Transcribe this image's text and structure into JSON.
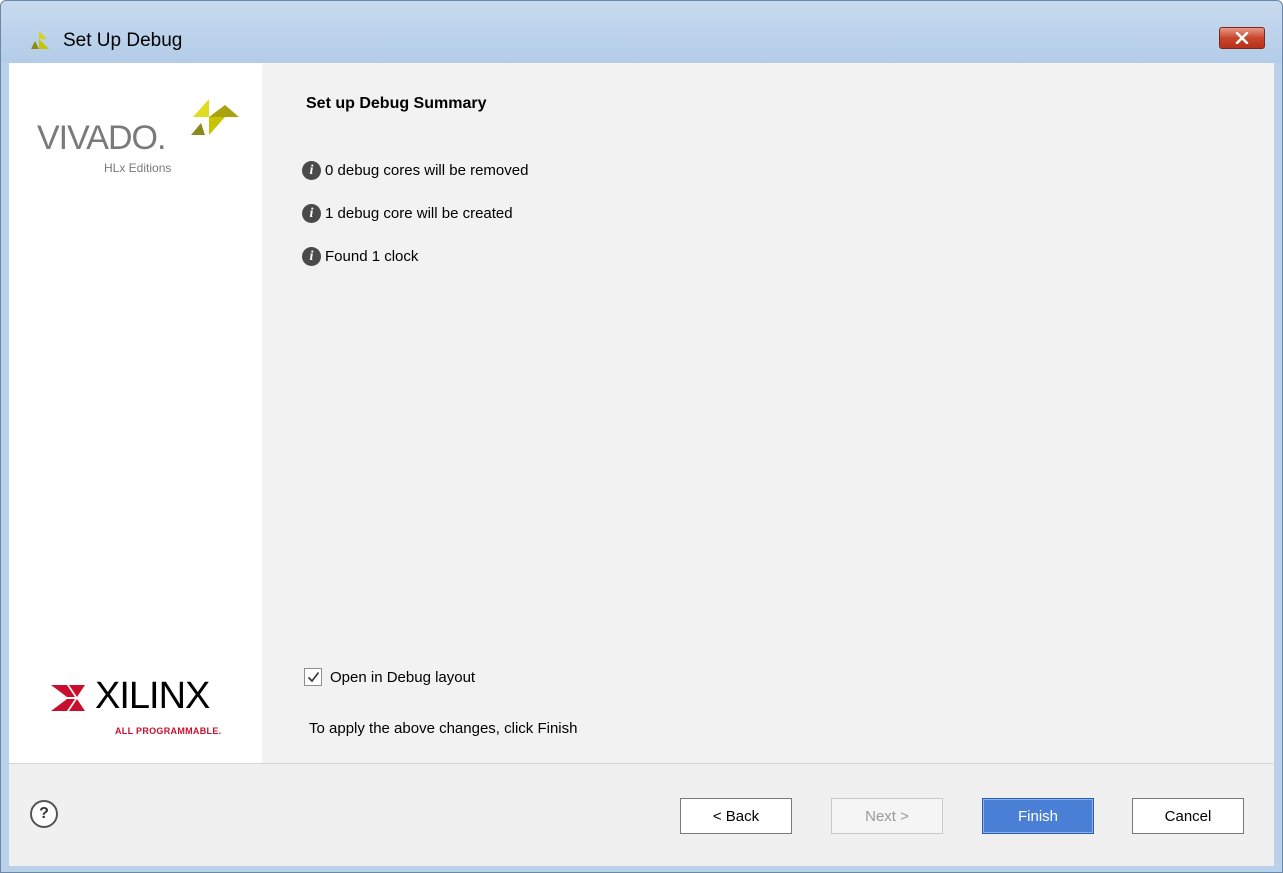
{
  "window": {
    "title": "Set Up Debug"
  },
  "sidebar": {
    "vivado_logo_text": "VIVADO.",
    "vivado_edition": "HLx Editions",
    "xilinx_logo_text": "XILINX",
    "xilinx_tagline": "ALL PROGRAMMABLE."
  },
  "content": {
    "title": "Set up Debug Summary",
    "info_items": [
      {
        "text": "0 debug cores will be removed",
        "icon": "info-icon"
      },
      {
        "text": "1 debug core will be created",
        "icon": "info-icon"
      },
      {
        "text": "Found 1 clock",
        "icon": "info-icon"
      }
    ],
    "checkbox_label": "Open in Debug layout",
    "checkbox_checked": true,
    "apply_text": "To apply the above changes, click Finish"
  },
  "footer": {
    "help_label": "?",
    "back_label": "< Back",
    "next_label": "Next >",
    "finish_label": "Finish",
    "cancel_label": "Cancel"
  },
  "colors": {
    "titlebar": "#b9d1ea",
    "close_button": "#c8452c",
    "primary_button": "#4a7fd6",
    "brand_yellow": "#c9c400",
    "xilinx_red": "#c8102e"
  }
}
